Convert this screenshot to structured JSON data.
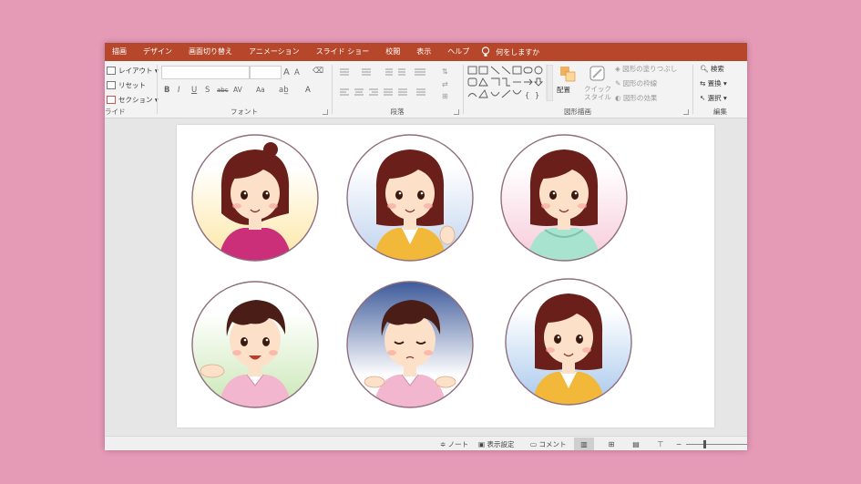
{
  "menubar": {
    "tabs": [
      "描画",
      "デザイン",
      "画面切り替え",
      "アニメーション",
      "スライド ショー",
      "校閲",
      "表示",
      "ヘルプ"
    ],
    "tell_me": "何をしますか"
  },
  "ribbon": {
    "slides": {
      "layout": "レイアウト",
      "reset": "リセット",
      "section": "セクション",
      "label": "ライド"
    },
    "font": {
      "label": "フォント",
      "size_up": "A",
      "size_down": "A",
      "bold": "B",
      "italic": "I",
      "underline": "U",
      "shadow": "S",
      "strike": "abc",
      "spacing": "AV",
      "case": "Aa",
      "color": "A"
    },
    "paragraph": {
      "label": "段落"
    },
    "drawing": {
      "label": "図形描画",
      "arrange": "配置",
      "quick_styles": "クイック スタイル",
      "fill": "図形の塗りつぶし",
      "outline": "図形の枠線",
      "effects": "図形の効果"
    },
    "editing": {
      "label": "編集",
      "find": "検索",
      "replace": "置換",
      "select": "選択"
    }
  },
  "statusbar": {
    "notes": "ノート",
    "display_settings": "表示設定",
    "comments": "コメント",
    "zoom_minus": "−"
  },
  "slide": {
    "avatars": [
      {
        "name": "woman-ponytail-pink",
        "bg": "#fde7a5",
        "hair": "#6b1f1a",
        "shirt": "#cc2f7a"
      },
      {
        "name": "woman-waving-yellow",
        "bg": "#bfd2ee",
        "hair": "#6b1f1a",
        "shirt": "#f2b83a"
      },
      {
        "name": "woman-mint-hoodie",
        "bg": "#f7cad8",
        "hair": "#6b1f1a",
        "shirt": "#a8e3cf"
      },
      {
        "name": "man-presenting",
        "bg": "#c9e7b4",
        "hair": "#4a1e16",
        "shirt": "#f3b6cf"
      },
      {
        "name": "man-shrugging",
        "bg": "#3d5a9a",
        "hair": "#4a1e16",
        "shirt": "#f3b6cf"
      },
      {
        "name": "woman-yellow-cardigan",
        "bg": "#a7c8ec",
        "hair": "#6b1f1a",
        "shirt": "#f2b83a"
      }
    ]
  }
}
